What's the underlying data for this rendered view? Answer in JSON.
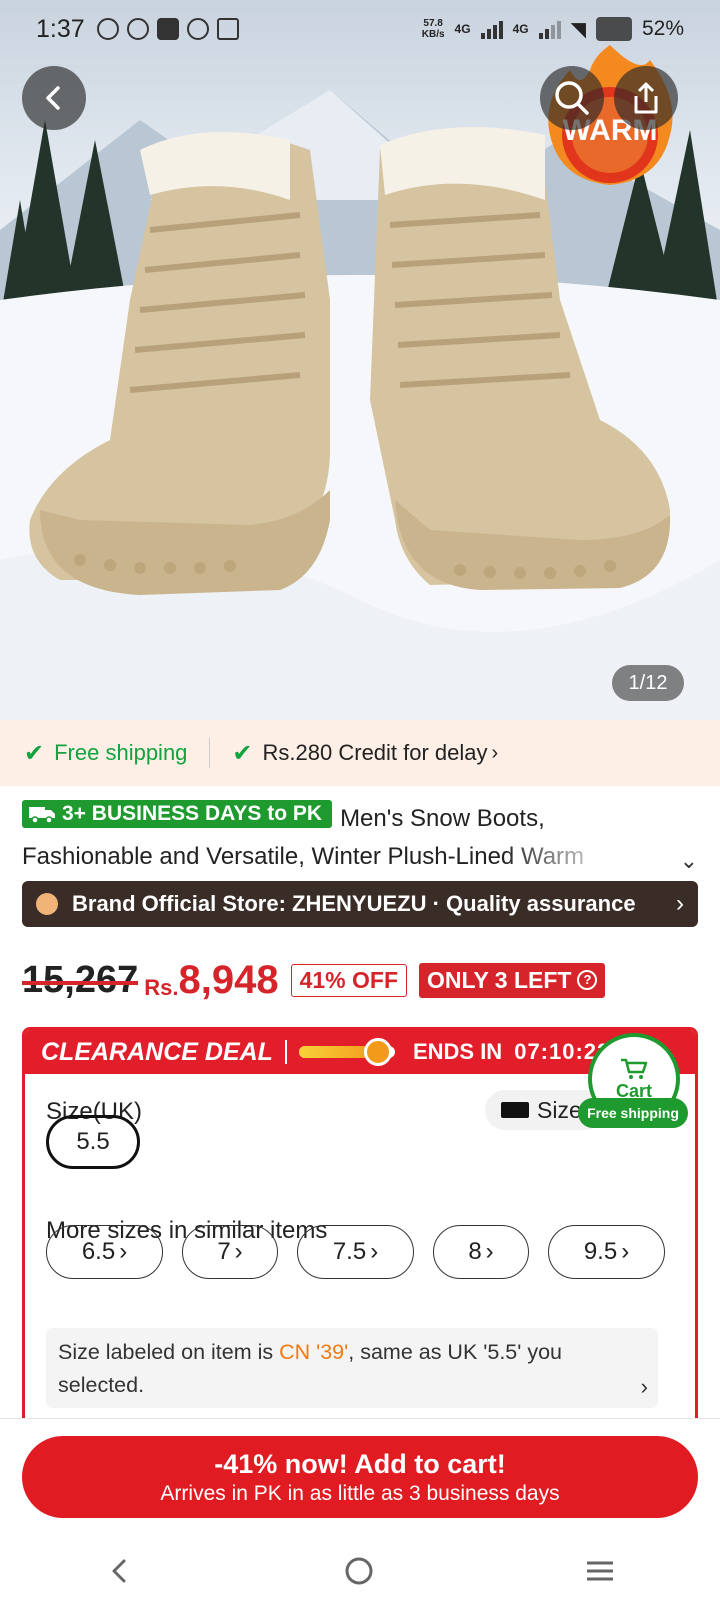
{
  "status_bar": {
    "time": "1:37",
    "net_speed_value": "57.8",
    "net_speed_unit": "KB/s",
    "net1": "4G",
    "net2": "4G",
    "battery": "52%"
  },
  "hero": {
    "badge_text": "WARM",
    "page_counter": "1/12"
  },
  "shipping_banner": {
    "free_shipping": "Free shipping",
    "credit": "Rs.280 Credit for delay"
  },
  "product": {
    "delivery_badge": "3+ BUSINESS DAYS to PK",
    "title_line1": "Men's Snow Boots,",
    "title_line2": "Fashionable and Versatile, Winter Plush-Lined Warm"
  },
  "brand_bar": {
    "text": "Brand Official Store: ZHENYUEZU · Quality assurance"
  },
  "price": {
    "original": "15,267",
    "currency": "Rs.",
    "current": "8,948",
    "discount": "41% OFF",
    "stock": "ONLY 3 LEFT",
    "stock_help": "?"
  },
  "deal": {
    "title": "CLEARANCE DEAL",
    "progress": 0.82,
    "ends_label": "ENDS IN",
    "countdown": "07:10:22:23"
  },
  "sizes": {
    "label": "Size(UK)",
    "guide_label": "Size",
    "selected": "5.5",
    "more_label": "More sizes in similar items",
    "similar": [
      "6.5",
      "7",
      "7.5",
      "8",
      "9.5"
    ],
    "info_prefix": "Size labeled on item is ",
    "info_cn": "CN '39'",
    "info_suffix": ", same as UK '5.5' you selected."
  },
  "cart_float": {
    "label": "Cart",
    "free_shipping": "Free shipping"
  },
  "cta": {
    "line1": "-41% now! Add to cart!",
    "line2": "Arrives in PK in as little as 3 business days"
  },
  "colors": {
    "accent_red": "#e01b22",
    "green": "#1e9a2f",
    "brand_bar": "#3a2d27",
    "orange": "#f07a14"
  },
  "icons": {
    "back": "back-arrow-icon",
    "search": "search-icon",
    "share": "share-icon",
    "cart": "cart-icon",
    "ruler": "ruler-icon",
    "check": "check-icon",
    "truck": "truck-icon"
  }
}
